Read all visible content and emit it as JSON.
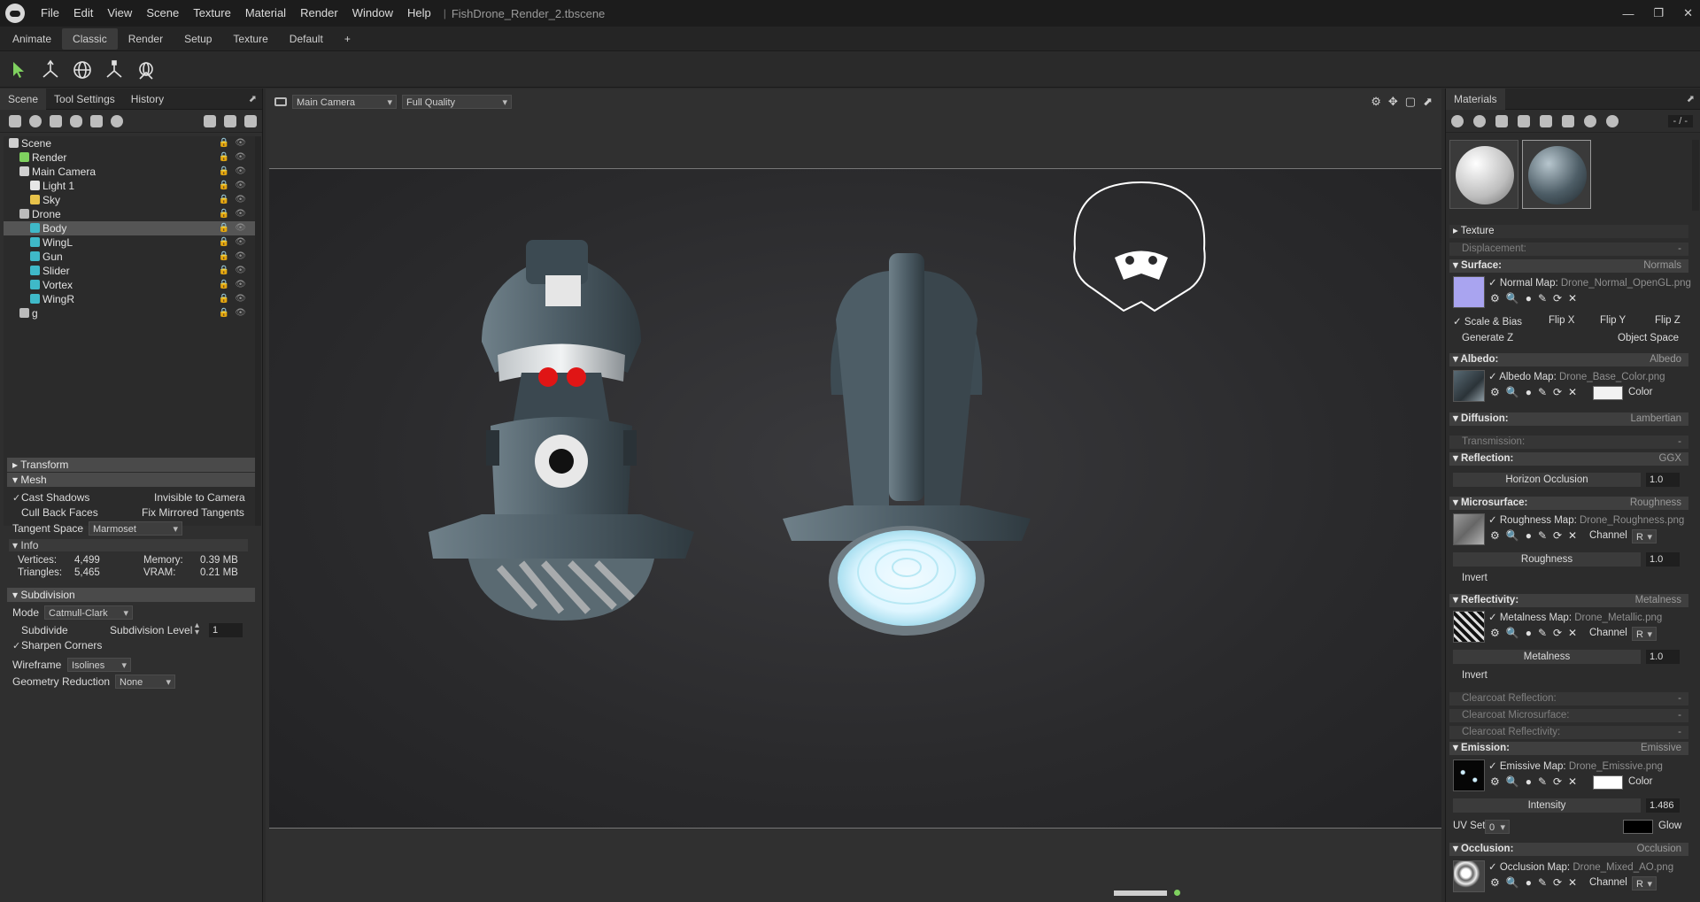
{
  "titlebar": {
    "menu": [
      "File",
      "Edit",
      "View",
      "Scene",
      "Texture",
      "Material",
      "Render",
      "Window",
      "Help"
    ],
    "separator": "|",
    "filename": "FishDrone_Render_2.tbscene",
    "controls": [
      "—",
      "❐",
      "✕"
    ]
  },
  "workspace_tabs": [
    "Animate",
    "Classic",
    "Render",
    "Setup",
    "Texture",
    "Default",
    "+"
  ],
  "left_panel": {
    "tabs": [
      "Scene",
      "Tool Settings",
      "History"
    ],
    "tree": [
      {
        "label": "Scene",
        "depth": 0,
        "icon": "scene-icon",
        "color": "#cfcfcf"
      },
      {
        "label": "Render",
        "depth": 1,
        "icon": "render-icon",
        "color": "#7fd15f"
      },
      {
        "label": "Main Camera",
        "depth": 1,
        "icon": "camera-icon",
        "color": "#d0d0d0"
      },
      {
        "label": "Light 1",
        "depth": 2,
        "icon": "light-icon",
        "color": "#e6e6e6"
      },
      {
        "label": "Sky",
        "depth": 2,
        "icon": "sky-icon",
        "color": "#e8c34a"
      },
      {
        "label": "Drone",
        "depth": 1,
        "icon": "group-icon",
        "color": "#bcbcbc"
      },
      {
        "label": "Body",
        "depth": 2,
        "icon": "mesh-icon",
        "color": "#3fb9c8",
        "selected": true
      },
      {
        "label": "WingL",
        "depth": 2,
        "icon": "mesh-icon",
        "color": "#3fb9c8"
      },
      {
        "label": "Gun",
        "depth": 2,
        "icon": "mesh-icon",
        "color": "#3fb9c8"
      },
      {
        "label": "Slider",
        "depth": 2,
        "icon": "mesh-icon",
        "color": "#3fb9c8"
      },
      {
        "label": "Vortex",
        "depth": 2,
        "icon": "mesh-icon",
        "color": "#3fb9c8"
      },
      {
        "label": "WingR",
        "depth": 2,
        "icon": "mesh-icon",
        "color": "#3fb9c8"
      },
      {
        "label": "g",
        "depth": 1,
        "icon": "group-icon",
        "color": "#bcbcbc"
      }
    ],
    "transform_label": "Transform",
    "mesh_label": "Mesh",
    "cast_shadows": "Cast Shadows",
    "invisible_to_camera": "Invisible to Camera",
    "cull_back_faces": "Cull Back Faces",
    "fix_mirrored_tangents": "Fix Mirrored Tangents",
    "tangent_space_label": "Tangent Space",
    "tangent_space_value": "Marmoset",
    "info_label": "Info",
    "vertices_label": "Vertices:",
    "vertices_value": "4,499",
    "triangles_label": "Triangles:",
    "triangles_value": "5,465",
    "memory_label": "Memory:",
    "memory_value": "0.39 MB",
    "vram_label": "VRAM:",
    "vram_value": "0.21 MB",
    "subdivision_label": "Subdivision",
    "mode_label": "Mode",
    "mode_value": "Catmull-Clark",
    "subdivide_label": "Subdivide",
    "subdivision_level_label": "Subdivision Level",
    "subdivision_level_value": "1",
    "sharpen_corners": "Sharpen Corners",
    "wireframe_label": "Wireframe",
    "wireframe_value": "Isolines",
    "geometry_reduction_label": "Geometry Reduction",
    "geometry_reduction_value": "None"
  },
  "viewport": {
    "camera": "Main Camera",
    "quality": "Full Quality"
  },
  "materials": {
    "title": "Materials",
    "counter": "- / -",
    "texture": "Texture",
    "displacement": "Displacement:",
    "displacement_value": "-",
    "surface": "Surface:",
    "surface_value": "Normals",
    "normal_map_label": "Normal Map:",
    "normal_map_file": "Drone_Normal_OpenGL.png",
    "scale_bias": "Scale & Bias",
    "flip_x": "Flip X",
    "flip_y": "Flip Y",
    "flip_z": "Flip Z",
    "generate_z": "Generate Z",
    "object_space": "Object Space",
    "albedo": "Albedo:",
    "albedo_value": "Albedo",
    "albedo_map_label": "Albedo Map:",
    "albedo_map_file": "Drone_Base_Color.png",
    "color_label": "Color",
    "diffusion": "Diffusion:",
    "diffusion_value": "Lambertian",
    "transmission": "Transmission:",
    "transmission_value": "-",
    "reflection": "Reflection:",
    "reflection_value": "GGX",
    "horizon_occlusion": "Horizon Occlusion",
    "horizon_occlusion_value": "1.0",
    "microsurface": "Microsurface:",
    "microsurface_value": "Roughness",
    "roughness_map_label": "Roughness Map:",
    "roughness_map_file": "Drone_Roughness.png",
    "channel_label": "Channel",
    "channel_value": "R",
    "roughness_label": "Roughness",
    "roughness_value": "1.0",
    "invert_label": "Invert",
    "reflectivity": "Reflectivity:",
    "reflectivity_value": "Metalness",
    "metalness_map_label": "Metalness Map:",
    "metalness_map_file": "Drone_Metallic.png",
    "metalness_label": "Metalness",
    "metalness_value": "1.0",
    "clearcoat_reflection": "Clearcoat Reflection:",
    "clearcoat_microsurface": "Clearcoat Microsurface:",
    "clearcoat_reflectivity": "Clearcoat Reflectivity:",
    "emission": "Emission:",
    "emission_value": "Emissive",
    "emissive_map_label": "Emissive Map:",
    "emissive_map_file": "Drone_Emissive.png",
    "intensity_label": "Intensity",
    "intensity_value": "1.486",
    "uv_set_label": "UV Set",
    "uv_set_value": "0",
    "glow_label": "Glow",
    "occlusion": "Occlusion:",
    "occlusion_value": "Occlusion",
    "occlusion_map_label": "Occlusion Map:",
    "occlusion_map_file": "Drone_Mixed_AO.png"
  },
  "colors": {
    "accent_green": "#7fd15f",
    "mesh_cyan": "#3fb9c8",
    "drone_body": "#4d5d66",
    "emissive_glow": "#dff6ff",
    "eye_red": "#e01515"
  }
}
